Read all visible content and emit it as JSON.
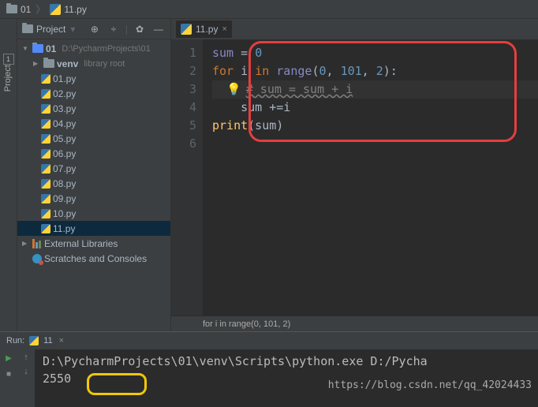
{
  "breadcrumb": {
    "folder": "01",
    "file": "11.py"
  },
  "project": {
    "title": "Project",
    "root": {
      "name": "01",
      "path": "D:\\PycharmProjects\\01"
    },
    "venv": {
      "name": "venv",
      "tag": "library root"
    },
    "files": [
      "01.py",
      "02.py",
      "03.py",
      "04.py",
      "05.py",
      "06.py",
      "07.py",
      "08.py",
      "09.py",
      "10.py",
      "11.py"
    ],
    "selected": "11.py",
    "external": "External Libraries",
    "scratches": "Scratches and Consoles"
  },
  "tabs": [
    {
      "name": "11.py"
    }
  ],
  "code": {
    "lines": [
      "1",
      "2",
      "3",
      "4",
      "5",
      "6"
    ],
    "l1_a": "sum",
    "l1_b": " = ",
    "l1_c": "0",
    "l2_a": "for ",
    "l2_b": "i ",
    "l2_c": "in ",
    "l2_d": "range",
    "l2_e": "(",
    "l2_f": "0",
    "l2_g": ", ",
    "l2_h": "101",
    "l2_i": ", ",
    "l2_j": "2",
    "l2_k": "):",
    "l3_a": "# sum = sum + i",
    "l4_a": "sum +=i",
    "l5_a": "print",
    "l5_b": "(sum)"
  },
  "crumb": "for i in range(0, 101, 2)",
  "run": {
    "label": "Run:",
    "config": "11",
    "cmd": "D:\\PycharmProjects\\01\\venv\\Scripts\\python.exe D:/Pycha",
    "result": "2550",
    "watermark": "https://blog.csdn.net/qq_42024433"
  },
  "rail": {
    "label": "Project",
    "num": "1"
  }
}
